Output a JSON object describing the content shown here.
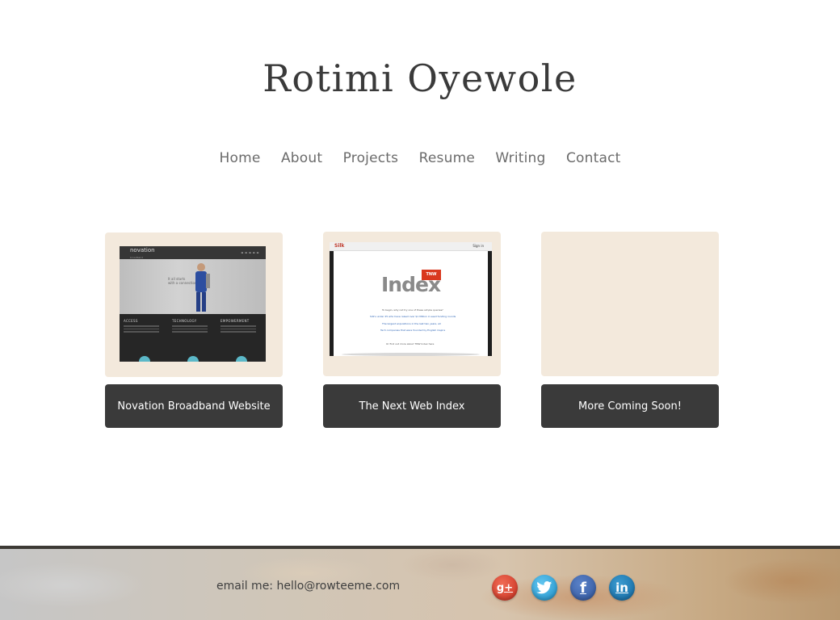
{
  "site": {
    "title": "Rotimi Oyewole"
  },
  "nav": {
    "items": [
      {
        "label": "Home"
      },
      {
        "label": "About"
      },
      {
        "label": "Projects"
      },
      {
        "label": "Resume"
      },
      {
        "label": "Writing"
      },
      {
        "label": "Contact"
      }
    ]
  },
  "projects": [
    {
      "label": "Novation Broadband Website",
      "thumbnail": {
        "logo": "novation",
        "logo_sub": "broadband",
        "tagline_1": "It all starts",
        "tagline_2": "with a connection",
        "columns": [
          "ACCESS",
          "TECHNOLOGY",
          "EMPOWERMENT"
        ]
      }
    },
    {
      "label": "The Next Web Index",
      "thumbnail": {
        "brand": "Silk",
        "signin": "Sign in",
        "badge": "TNW",
        "heading": "Index",
        "question": "To begin, why not try one of these simple queries?",
        "links": [
          "Silk's under 25 who have raised over $1 Million in seed funding rounds",
          "The largest acquisitions in the last two years, all",
          "Tech companies that were founded by English majors"
        ],
        "footer": "Or find out more about TNW Index here"
      }
    },
    {
      "label": "More Coming Soon!"
    }
  ],
  "footer": {
    "email_prefix": "email me:",
    "email": "hello@rowteeme.com",
    "social": [
      {
        "name": "google-plus-icon",
        "glyph": "g+"
      },
      {
        "name": "twitter-icon",
        "glyph": ""
      },
      {
        "name": "facebook-icon",
        "glyph": "f"
      },
      {
        "name": "linkedin-icon",
        "glyph": "in"
      }
    ]
  },
  "colors": {
    "card_bg": "#f3e9dc",
    "button_bg": "#3a3a3a",
    "title": "#3a3a3a",
    "nav": "#6b6b6b"
  }
}
